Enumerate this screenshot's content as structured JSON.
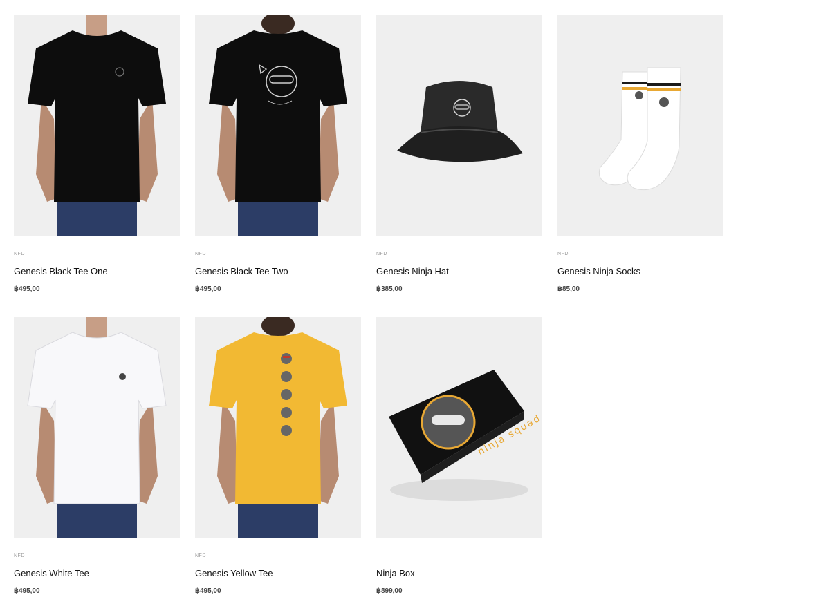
{
  "products": [
    {
      "brand": "NFD",
      "title": "Genesis Black Tee One",
      "price": "฿495,00",
      "image": "black-tee-front"
    },
    {
      "brand": "NFD",
      "title": "Genesis Black Tee Two",
      "price": "฿495,00",
      "image": "black-tee-back"
    },
    {
      "brand": "NFD",
      "title": "Genesis Ninja Hat",
      "price": "฿385,00",
      "image": "bucket-hat"
    },
    {
      "brand": "NFD",
      "title": "Genesis Ninja Socks",
      "price": "฿85,00",
      "image": "socks"
    },
    {
      "brand": "NFD",
      "title": "Genesis White Tee",
      "price": "฿495,00",
      "image": "white-tee-front"
    },
    {
      "brand": "NFD",
      "title": "Genesis Yellow Tee",
      "price": "฿495,00",
      "image": "yellow-tee-back"
    },
    {
      "brand": "",
      "title": "Ninja Box",
      "price": "฿899,00",
      "image": "ninja-box",
      "box_text": "ninja squad"
    }
  ],
  "colors": {
    "thumb_bg": "#efefef",
    "black_fabric": "#0d0d0d",
    "yellow_fabric": "#f2b933",
    "accent_gold": "#e8a834"
  }
}
